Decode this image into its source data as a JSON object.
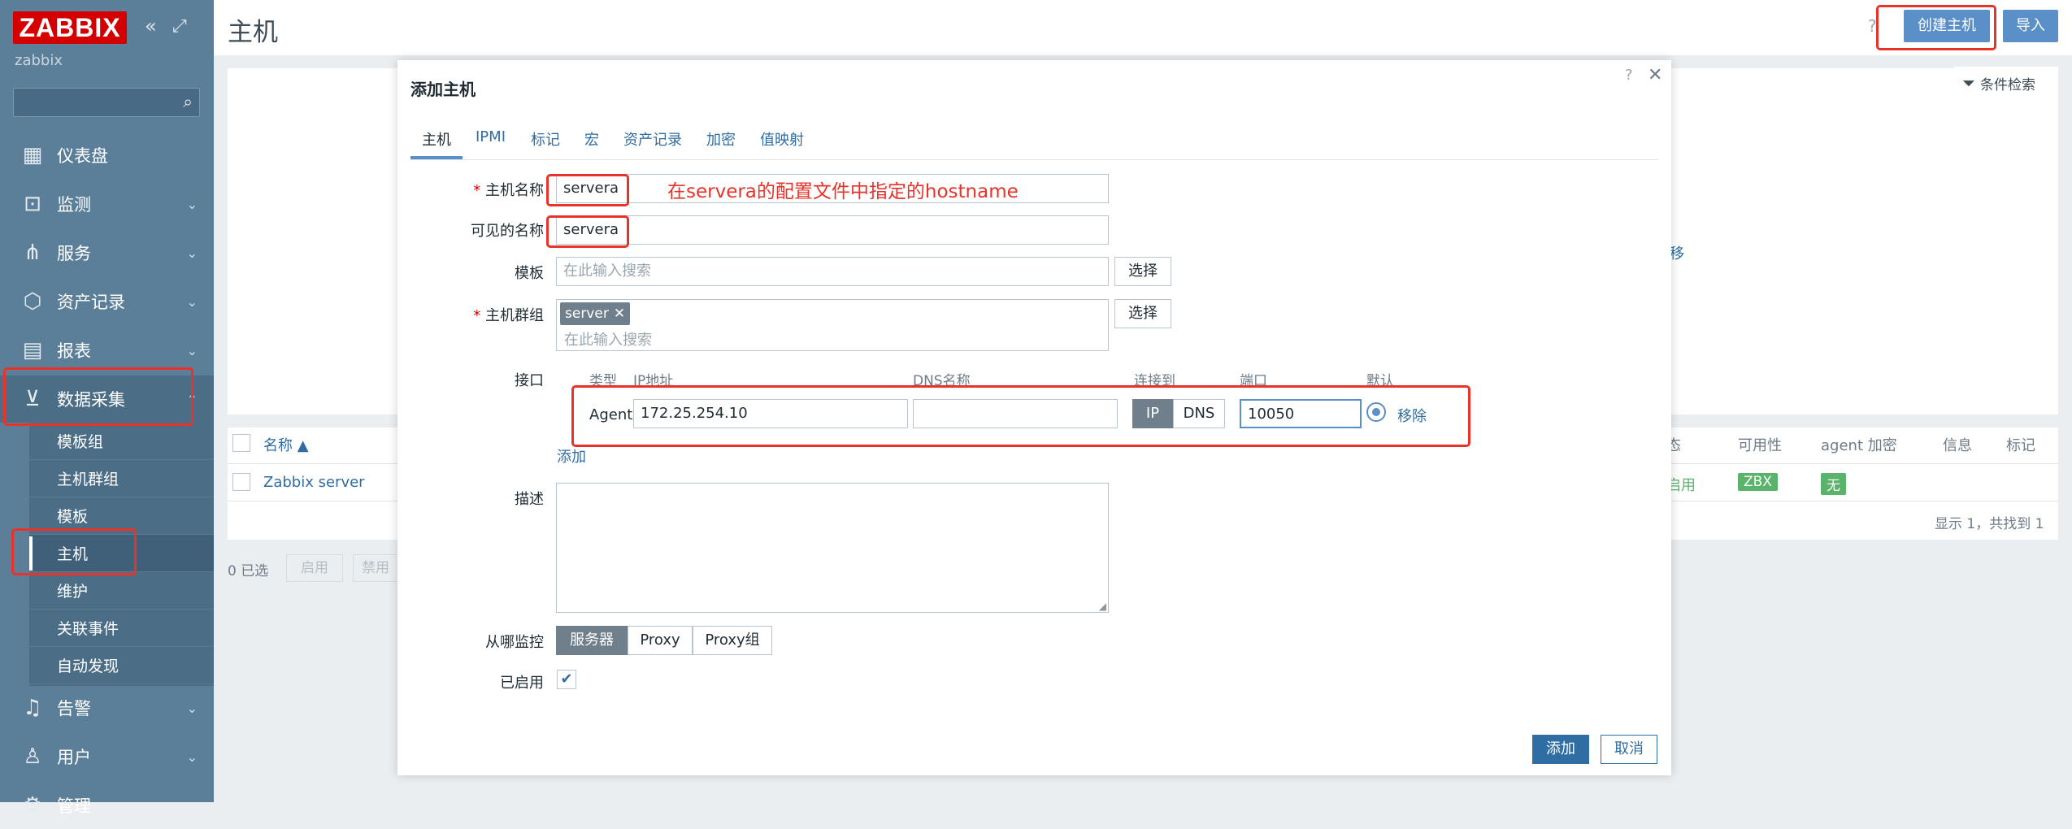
{
  "sidebar": {
    "logo": "ZABBIX",
    "server_name": "zabbix",
    "nav": [
      {
        "label": "仪表盘",
        "icon": "dashboard-icon"
      },
      {
        "label": "监测",
        "icon": "monitoring-icon"
      },
      {
        "label": "服务",
        "icon": "services-icon"
      },
      {
        "label": "资产记录",
        "icon": "inventory-icon"
      },
      {
        "label": "报表",
        "icon": "reports-icon"
      },
      {
        "label": "数据采集",
        "icon": "data-collection-icon"
      },
      {
        "label": "告警",
        "icon": "alerts-icon"
      },
      {
        "label": "用户",
        "icon": "users-icon"
      },
      {
        "label": "管理",
        "icon": "administration-icon"
      }
    ],
    "sub_items": [
      "模板组",
      "主机群组",
      "模板",
      "主机",
      "维护",
      "关联事件",
      "自动发现"
    ]
  },
  "header": {
    "title": "主机",
    "help": "?",
    "create_host": "创建主机",
    "import": "导入",
    "filter": "条件检索"
  },
  "table": {
    "columns": [
      "名称 ▲",
      "态",
      "可用性",
      "agent 加密",
      "信息",
      "标记"
    ],
    "row": {
      "name": "Zabbix server",
      "status": "启用",
      "availability": "ZBX",
      "encryption": "无"
    },
    "summary": "显示 1，共找到 1",
    "selected": "0 已选",
    "enable": "启用",
    "disable": "禁用",
    "remove_fragment": "移"
  },
  "modal": {
    "title": "添加主机",
    "help": "?",
    "close": "✕",
    "tabs": [
      "主机",
      "IPMI",
      "标记",
      "宏",
      "资产记录",
      "加密",
      "值映射"
    ],
    "host_name_label": "主机名称",
    "host_name_value": "servera",
    "annotation": "在servera的配置文件中指定的hostname",
    "visible_name_label": "可见的名称",
    "visible_name_value": "servera",
    "templates_label": "模板",
    "search_placeholder": "在此输入搜索",
    "select_button": "选择",
    "groups_label": "主机群组",
    "group_tag": "server",
    "interfaces_label": "接口",
    "iface_headers": {
      "type": "类型",
      "ip": "IP地址",
      "dns": "DNS名称",
      "connect": "连接到",
      "port": "端口",
      "default": "默认"
    },
    "iface_type": "Agent",
    "iface_ip": "172.25.254.10",
    "iface_dns": "",
    "connect_ip": "IP",
    "connect_dns": "DNS",
    "iface_port": "10050",
    "iface_remove": "移除",
    "add_link": "添加",
    "description_label": "描述",
    "monitored_by_label": "从哪监控",
    "monitored_by_options": [
      "服务器",
      "Proxy",
      "Proxy组"
    ],
    "enabled_label": "已启用",
    "add_button": "添加",
    "cancel_button": "取消"
  },
  "colors": {
    "accent": "#5b8fc7",
    "sidebar": "#5c7f99",
    "highlight": "#e8322a",
    "green": "#59b36b"
  }
}
